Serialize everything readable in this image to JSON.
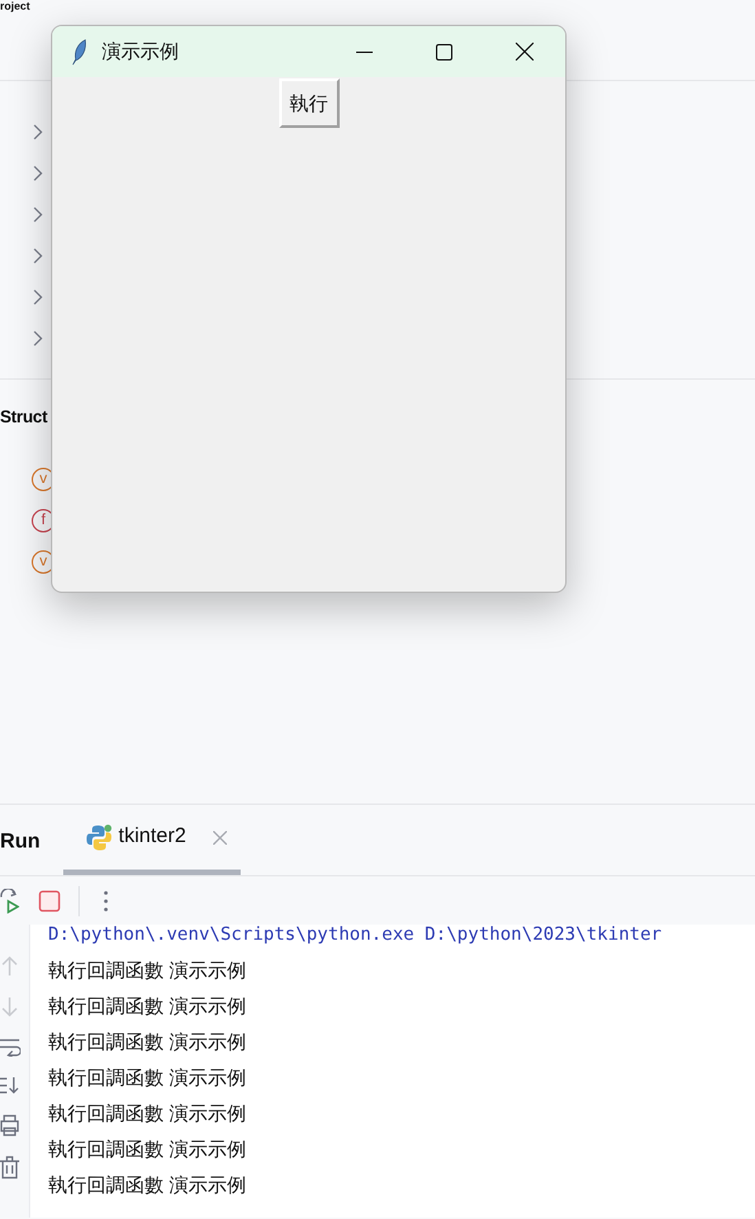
{
  "project_panel": {
    "title": "roject",
    "tree_items": [
      {
        "expanded": false
      },
      {
        "expanded": false
      },
      {
        "expanded": false
      },
      {
        "expanded": false
      },
      {
        "expanded": false
      },
      {
        "expanded": false
      }
    ]
  },
  "structure_panel": {
    "title": "Struct",
    "items": [
      {
        "glyph": "v",
        "color": "#d9772b"
      },
      {
        "glyph": "f",
        "color": "#c7434f"
      },
      {
        "glyph": "v",
        "color": "#d9772b"
      }
    ]
  },
  "dialog": {
    "title": "演示示例",
    "button": "執行"
  },
  "run_panel": {
    "title": "Run",
    "tabs": [
      {
        "label": "tkinter2",
        "selected": true
      }
    ],
    "console": {
      "command": "D:\\python\\.venv\\Scripts\\python.exe D:\\python\\2023\\tkinter",
      "lines": [
        "執行回調函數 演示示例",
        "執行回調函數 演示示例",
        "執行回調函數 演示示例",
        "執行回調函數 演示示例",
        "執行回調函數 演示示例",
        "執行回調函數 演示示例",
        "執行回調函數 演示示例"
      ]
    }
  }
}
